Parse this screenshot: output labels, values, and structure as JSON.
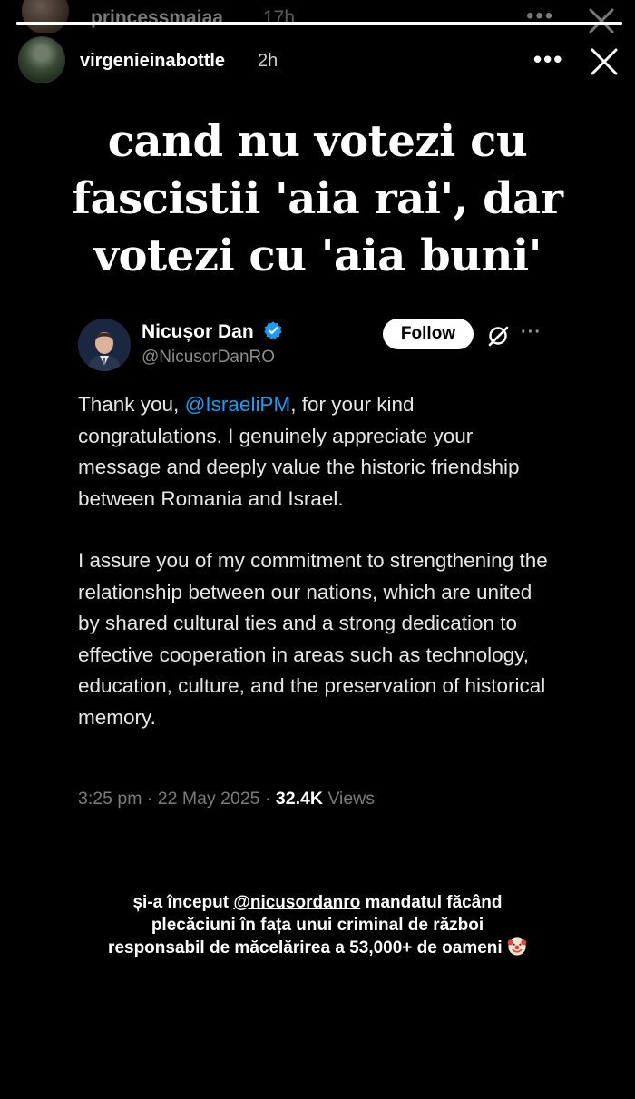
{
  "ghost_story": {
    "username": "princessmaiaa",
    "time": "17h"
  },
  "story": {
    "progress": 1.0,
    "username": "virgenieinabottle",
    "time": "2h",
    "more": "•••",
    "headline_lines": [
      "cand nu votezi cu",
      "fascistii 'aia rai', dar",
      "votezi cu 'aia buni'"
    ]
  },
  "tweet": {
    "author_name": "Nicușor Dan",
    "handle": "@NicusorDanRO",
    "follow_label": "Follow",
    "more": "···",
    "body": {
      "p1_prefix": "Thank you, ",
      "p1_mention": "@IsraeliPM",
      "p1_suffix": ", for your kind congratulations. I genuinely appreciate your message and deeply value the historic friendship between Romania and Israel.",
      "p2": "I assure you of my commitment to strengthening the relationship between our nations, which are united by shared cultural ties and a strong dedication to effective cooperation in areas such as technology, education, culture, and the preservation of historical memory."
    },
    "meta_time": "3:25 pm · 22 May 2025 · ",
    "views_count": "32.4K",
    "views_label": " Views"
  },
  "caption": {
    "prefix": "și-a început ",
    "tag": "@nicusordanro",
    "line1_suffix": " mandatul făcând",
    "line2": "plecăciuni în fața unui criminal de război",
    "line3": "responsabil de măcelărirea a 53,000+ de oameni",
    "emoji_icon": "clown-face-icon"
  }
}
